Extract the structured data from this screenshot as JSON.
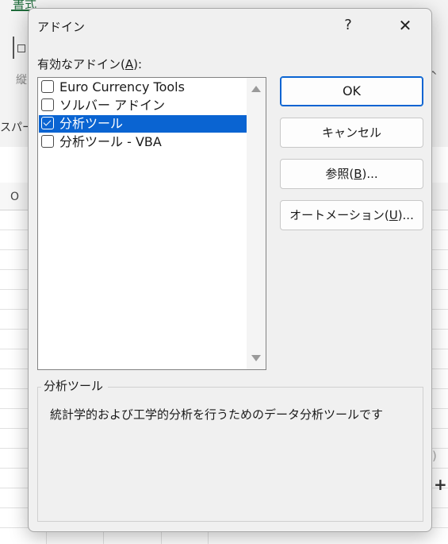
{
  "background": {
    "ribbon_tab": "書式",
    "ribbon_label_1": "縦",
    "ribbon_label_2": "スパー",
    "column_header": "O",
    "right_paren": ")",
    "right_plus": "+",
    "ribbon_chevron": "^"
  },
  "dialog": {
    "title": "アドイン",
    "help_label": "?",
    "close_label": "✕",
    "list_label_prefix": "有効なアドイン(",
    "list_label_accel": "A",
    "list_label_suffix": "):",
    "addins": [
      {
        "label": "Euro Currency Tools",
        "checked": false,
        "selected": false
      },
      {
        "label": "ソルバー アドイン",
        "checked": false,
        "selected": false
      },
      {
        "label": "分析ツール",
        "checked": true,
        "selected": true
      },
      {
        "label": "分析ツール - VBA",
        "checked": false,
        "selected": false
      }
    ],
    "buttons": {
      "ok": "OK",
      "cancel": "キャンセル",
      "browse_prefix": "参照(",
      "browse_accel": "B",
      "browse_suffix": ")...",
      "automation_prefix": "オートメーション(",
      "automation_accel": "U",
      "automation_suffix": ")..."
    },
    "description": {
      "title": "分析ツール",
      "text": "統計学的および工学的分析を行うためのデータ分析ツールです"
    }
  },
  "colors": {
    "selection": "#0a64d2",
    "dialog_bg": "#f0f0f0",
    "excel_green": "#1e6b3a"
  }
}
